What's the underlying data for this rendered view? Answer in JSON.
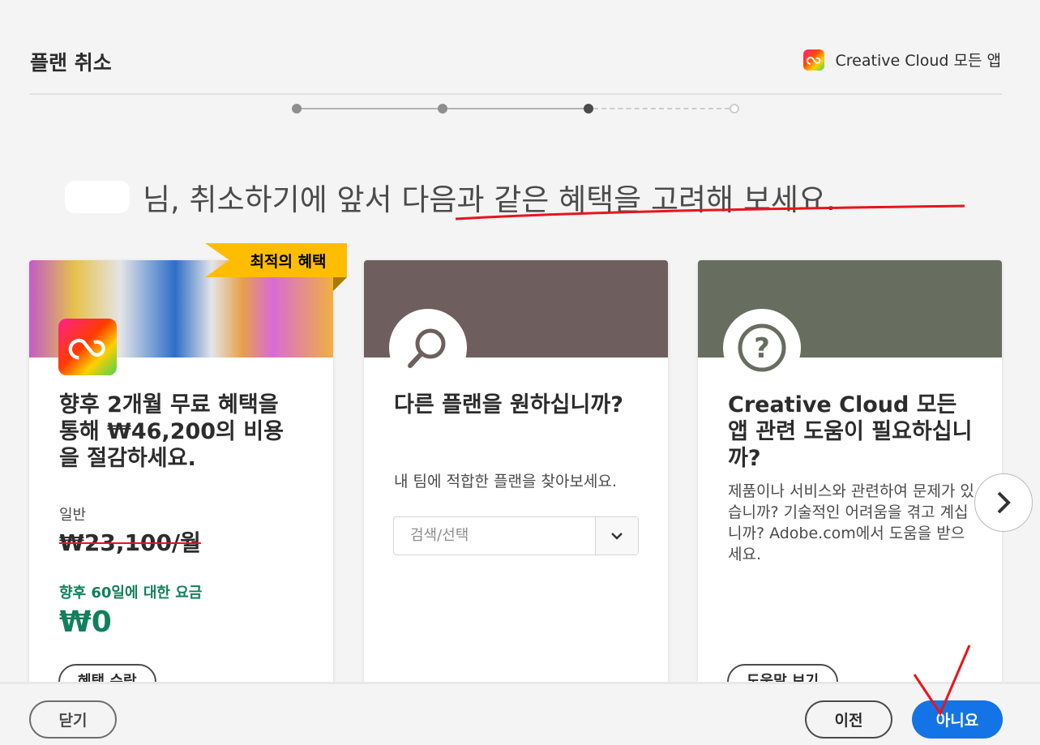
{
  "header": {
    "title": "플랜 취소",
    "brand": "Creative Cloud 모든 앱"
  },
  "stepper": {
    "total_steps": 4,
    "current_step": 3
  },
  "heading": {
    "suffix": "님, 취소하기에 앞서 다음과 같은 혜택을 고려해 보세요."
  },
  "cards": [
    {
      "badge": "최적의 혜택",
      "title": "향후 2개월 무료 혜택을 통해 ₩46,200의 비용을 절감하세요.",
      "regular_label": "일반",
      "regular_price": "₩23,100/월",
      "offer_label": "향후 60일에 대한 요금",
      "offer_price": "₩0",
      "button": "혜택 수락",
      "band_color": "#c9c9d2"
    },
    {
      "title": "다른 플랜을 원하십니까?",
      "desc": "내 팀에 적합한 플랜을 찾아보세요.",
      "select_placeholder": "검색/선택",
      "band_color": "#6e5f5e",
      "icon": "search-icon"
    },
    {
      "title": "Creative Cloud 모든 앱 관련 도움이 필요하십니까?",
      "desc": "제품이나 서비스와 관련하여 문제가 있습니까? 기술적인 어려움을 겪고 계십니까? Adobe.com에서 도움을 받으세요.",
      "button": "도움말 보기",
      "band_color": "#676d5f",
      "icon": "question-icon"
    }
  ],
  "footer": {
    "close": "닫기",
    "previous": "이전",
    "no": "아니요"
  },
  "colors": {
    "accent": "#1473e6",
    "offer_green": "#12805c",
    "badge": "#ffbd00",
    "annotation": "#e8141c"
  }
}
